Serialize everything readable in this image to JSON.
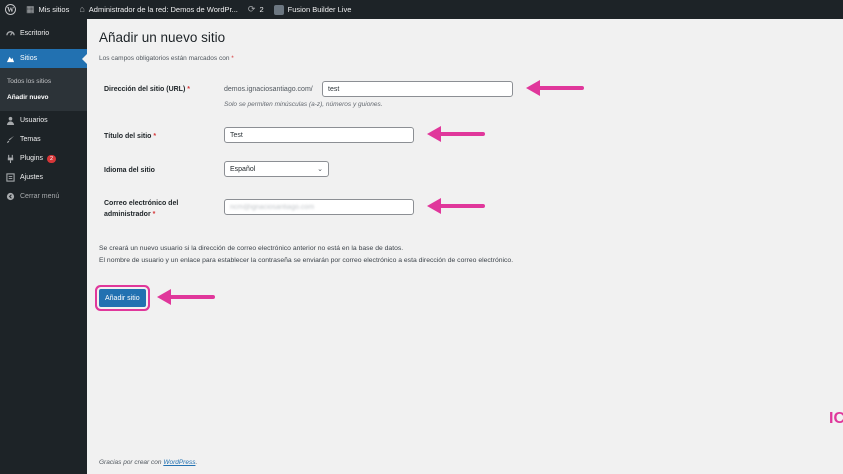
{
  "admin_bar": {
    "my_sites": "Mis sitios",
    "network_admin": "Administrador de la red: Demos de WordPr...",
    "updates_count": "2",
    "fusion": "Fusion Builder Live"
  },
  "sidebar": {
    "escritorio": "Escritorio",
    "sitios": "Sitios",
    "todos": "Todos los sitios",
    "anadir": "Añadir nuevo",
    "usuarios": "Usuarios",
    "temas": "Temas",
    "plugins": "Plugins",
    "plugins_badge": "2",
    "ajustes": "Ajustes",
    "cerrar": "Cerrar menú"
  },
  "page": {
    "title": "Añadir un nuevo sitio",
    "required_note": "Los campos obligatorios están marcados con",
    "required_star": "*"
  },
  "form": {
    "address_label": "Dirección del sitio (URL)",
    "address_prefix": "demos.ignaciosantiago.com/",
    "address_value": "test",
    "address_desc": "Solo se permiten minúsculas (a-z), números y guiones.",
    "title_label": "Título del sitio",
    "title_value": "Test",
    "language_label": "Idioma del sitio",
    "language_value": "Español",
    "email_label_1": "Correo electrónico del",
    "email_label_2": "administrador",
    "email_value": "ncm@ignaciosantiago.com",
    "info_line_1": "Se creará un nuevo usuario si la dirección de correo electrónico anterior no está en la base de datos.",
    "info_line_2": "El nombre de usuario y un enlace para establecer la contraseña se enviarán por correo electrónico a esta dirección de correo electrónico.",
    "submit_label": "Añadir sitio"
  },
  "footer": {
    "text": "Gracias por crear con",
    "link": "WordPress",
    "dot": "."
  },
  "colors": {
    "accent": "#2271b1",
    "arrow": "#e0379b",
    "adminbar": "#1d2327"
  }
}
